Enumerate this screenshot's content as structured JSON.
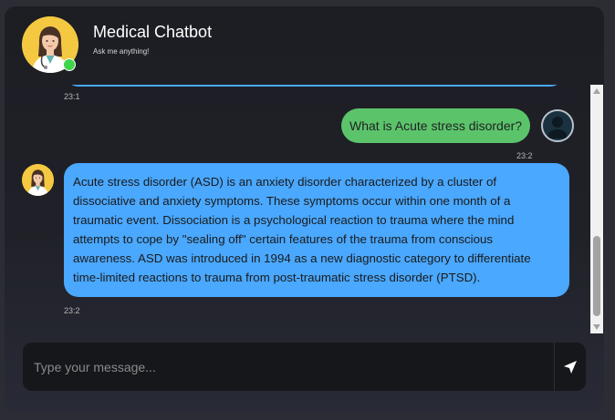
{
  "header": {
    "title": "Medical Chatbot",
    "subtitle": "Ask me anything!",
    "status": "online"
  },
  "messages": [
    {
      "sender": "bot",
      "time": "23:1"
    },
    {
      "sender": "user",
      "text": "What is Acute stress disorder?",
      "time": "23:2"
    },
    {
      "sender": "bot",
      "text": "Acute stress disorder (ASD) is an anxiety disorder characterized by a cluster of dissociative and anxiety symptoms. These symptoms occur within one month of a traumatic event. Dissociation is a psychological reaction to trauma where the mind attempts to cope by \"sealing off\" certain features of the trauma from conscious awareness. ASD was introduced in 1994 as a new diagnostic category to differentiate time-limited reactions to trauma from post-traumatic stress disorder (PTSD).",
      "time": "23:2"
    }
  ],
  "input": {
    "placeholder": "Type your message...",
    "value": ""
  },
  "icons": {
    "send": "paper-plane-icon",
    "bot_avatar": "doctor-avatar",
    "user_avatar": "user-avatar-icon"
  },
  "colors": {
    "bot_bubble": "#4aa8ff",
    "user_bubble": "#5bc46b",
    "online": "#3fd44a",
    "avatar_bg": "#f5c842"
  }
}
